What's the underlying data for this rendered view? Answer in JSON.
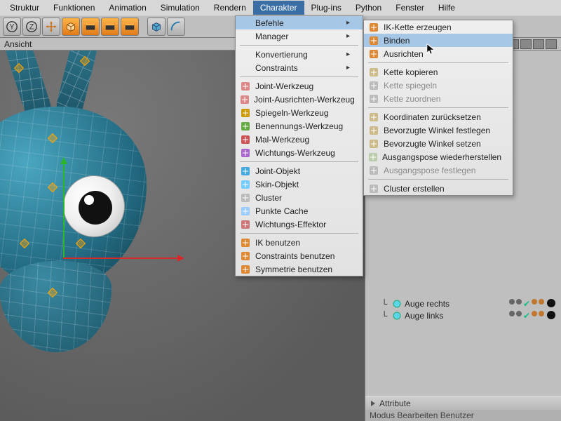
{
  "menubar": {
    "items": [
      "Struktur",
      "Funktionen",
      "Animation",
      "Simulation",
      "Rendern",
      "Charakter",
      "Plug-ins",
      "Python",
      "Fenster",
      "Hilfe"
    ],
    "active_index": 5
  },
  "toolbar": {
    "buttons": [
      "axis-y",
      "axis-z",
      "move-tool",
      "cube-primitive",
      "clapper-1",
      "clapper-2",
      "clapper-3",
      "cube-blue",
      "arc-tool",
      "misc-1",
      "misc-2"
    ]
  },
  "viewport": {
    "title": "Ansicht"
  },
  "char_menu": {
    "groups": [
      {
        "items": [
          {
            "label": "Befehle",
            "submenu": true,
            "highlight": true
          },
          {
            "label": "Manager",
            "submenu": true
          }
        ]
      },
      {
        "items": [
          {
            "label": "Konvertierung",
            "submenu": true
          },
          {
            "label": "Constraints",
            "submenu": true
          }
        ]
      },
      {
        "items": [
          {
            "label": "Joint-Werkzeug",
            "icon": "joint-tool"
          },
          {
            "label": "Joint-Ausrichten-Werkzeug",
            "icon": "joint-align"
          },
          {
            "label": "Spiegeln-Werkzeug",
            "icon": "mirror"
          },
          {
            "label": "Benennungs-Werkzeug",
            "icon": "naming"
          },
          {
            "label": "Mal-Werkzeug",
            "icon": "paint"
          },
          {
            "label": "Wichtungs-Werkzeug",
            "icon": "weight"
          }
        ]
      },
      {
        "items": [
          {
            "label": "Joint-Objekt",
            "icon": "joint-obj"
          },
          {
            "label": "Skin-Objekt",
            "icon": "skin"
          },
          {
            "label": "Cluster",
            "icon": "cluster"
          },
          {
            "label": "Punkte Cache",
            "icon": "point-cache"
          },
          {
            "label": "Wichtungs-Effektor",
            "icon": "weight-eff"
          }
        ]
      },
      {
        "items": [
          {
            "label": "IK benutzen",
            "icon": "ik-use"
          },
          {
            "label": "Constraints benutzen",
            "icon": "constraints-use"
          },
          {
            "label": "Symmetrie benutzen",
            "icon": "symmetry-use"
          }
        ]
      }
    ]
  },
  "befehle_submenu": {
    "groups": [
      {
        "items": [
          {
            "label": "IK-Kette erzeugen",
            "icon": "ik-chain"
          },
          {
            "label": "Binden",
            "icon": "bind",
            "highlight": true
          },
          {
            "label": "Ausrichten",
            "icon": "align"
          }
        ]
      },
      {
        "items": [
          {
            "label": "Kette kopieren",
            "icon": "copy-chain"
          },
          {
            "label": "Kette spiegeln",
            "icon": "mirror-chain",
            "disabled": true
          },
          {
            "label": "Kette zuordnen",
            "icon": "assign-chain",
            "disabled": true
          }
        ]
      },
      {
        "items": [
          {
            "label": "Koordinaten zurücksetzen",
            "icon": "reset-coord"
          },
          {
            "label": "Bevorzugte Winkel festlegen",
            "icon": "angle-fix"
          },
          {
            "label": "Bevorzugte Winkel setzen",
            "icon": "angle-set"
          },
          {
            "label": "Ausgangspose wiederherstellen",
            "icon": "pose-restore"
          },
          {
            "label": "Ausgangspose festlegen",
            "icon": "pose-set",
            "disabled": true
          }
        ]
      },
      {
        "items": [
          {
            "label": "Cluster erstellen",
            "icon": "cluster-create"
          }
        ]
      }
    ]
  },
  "tree": {
    "items": [
      {
        "label": "Auge rechts",
        "extra": true
      },
      {
        "label": "Auge links",
        "extra": true
      }
    ]
  },
  "attribute_panel": {
    "title": "Attribute"
  },
  "bottom": {
    "text": "Modus   Bearbeiten   Benutzer"
  },
  "colors": {
    "axis_x": "#d42a2a",
    "axis_y": "#2ab82a",
    "highlight": "#a6c7e6"
  }
}
